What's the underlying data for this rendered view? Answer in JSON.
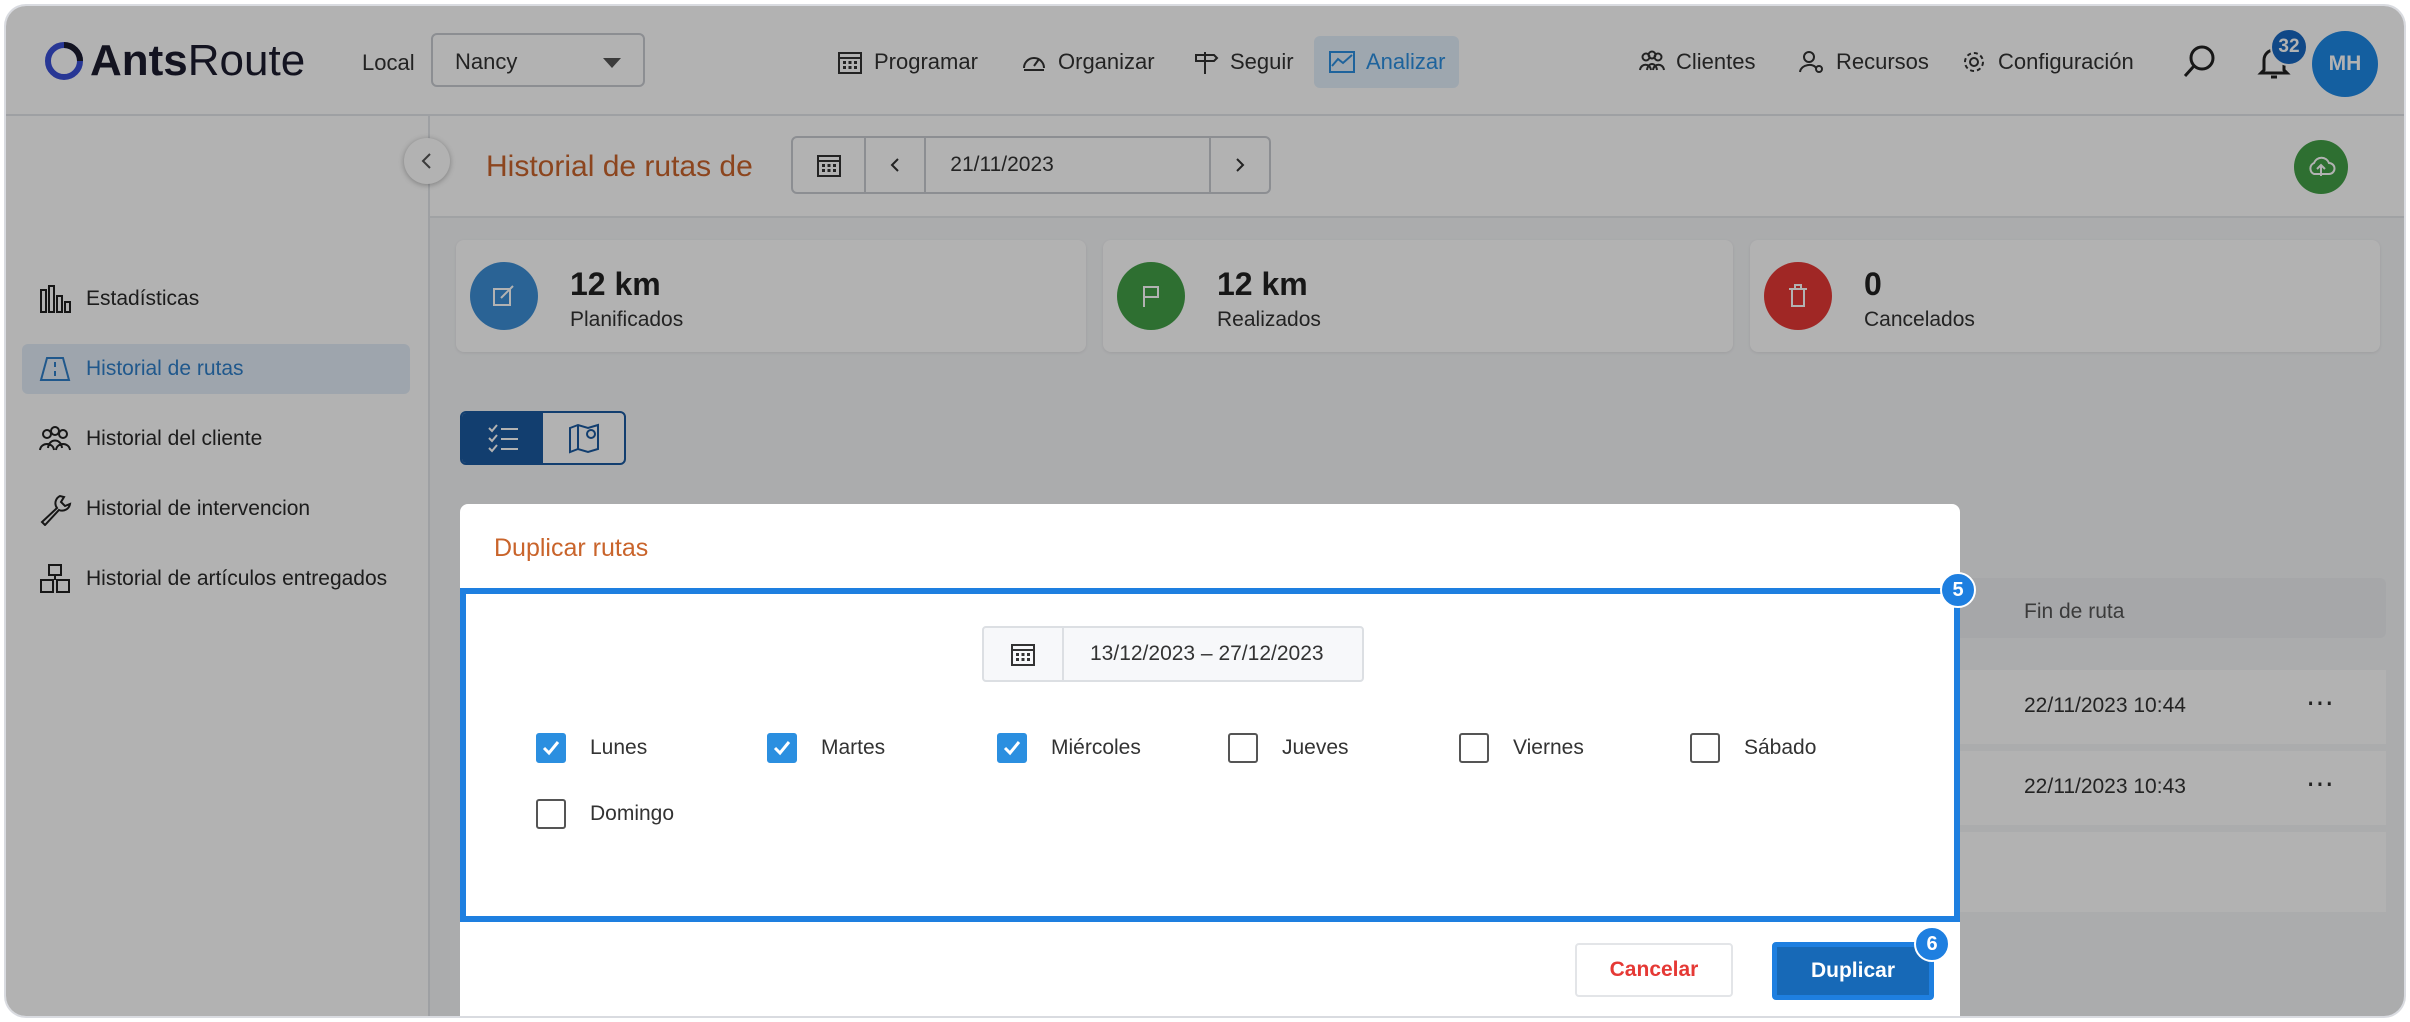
{
  "app": {
    "brand_bold": "Ants",
    "brand_light": "Route"
  },
  "header": {
    "local_label": "Local",
    "local_value": "Nancy",
    "nav": [
      {
        "label": "Programar",
        "icon": "calendar-icon"
      },
      {
        "label": "Organizar",
        "icon": "speedometer-icon"
      },
      {
        "label": "Seguir",
        "icon": "signpost-icon"
      },
      {
        "label": "Analizar",
        "icon": "chart-icon"
      }
    ],
    "right_nav": [
      {
        "label": "Clientes",
        "icon": "clients-icon"
      },
      {
        "label": "Recursos",
        "icon": "resources-icon"
      },
      {
        "label": "Configuración",
        "icon": "gear-icon"
      }
    ],
    "notification_count": "32",
    "avatar_initials": "MH"
  },
  "sidebar": {
    "items": [
      {
        "label": "Estadísticas",
        "icon": "bar-chart-icon"
      },
      {
        "label": "Historial de rutas",
        "icon": "road-icon"
      },
      {
        "label": "Historial del cliente",
        "icon": "people-icon"
      },
      {
        "label": "Historial de intervencion",
        "icon": "wrench-icon"
      },
      {
        "label": "Historial de artículos entregados",
        "icon": "boxes-icon"
      }
    ]
  },
  "page": {
    "title": "Historial de rutas de",
    "date": "21/11/2023"
  },
  "stats": [
    {
      "value": "12 km",
      "label": "Planificados",
      "color": "#3d8fd6"
    },
    {
      "value": "12 km",
      "label": "Realizados",
      "color": "#43a047"
    },
    {
      "value": "0",
      "label": "Cancelados",
      "color": "#e53935"
    }
  ],
  "background_table": {
    "column_header": "Fin de ruta",
    "rows": [
      {
        "fin": "22/11/2023 10:44"
      },
      {
        "fin": "22/11/2023 10:43"
      }
    ],
    "more_icon": "⋯"
  },
  "modal": {
    "title": "Duplicar rutas",
    "date_range": "13/12/2023 – 27/12/2023",
    "days": [
      {
        "label": "Lunes",
        "checked": true
      },
      {
        "label": "Martes",
        "checked": true
      },
      {
        "label": "Miércoles",
        "checked": true
      },
      {
        "label": "Jueves",
        "checked": false
      },
      {
        "label": "Viernes",
        "checked": false
      },
      {
        "label": "Sábado",
        "checked": false
      },
      {
        "label": "Domingo",
        "checked": false
      }
    ],
    "cancel_label": "Cancelar",
    "duplicate_label": "Duplicar"
  },
  "annotations": {
    "step_5": "5",
    "step_6": "6"
  },
  "colors": {
    "accent": "#1e7fe0",
    "title_orange": "#c9642b",
    "primary": "#1769b7"
  }
}
